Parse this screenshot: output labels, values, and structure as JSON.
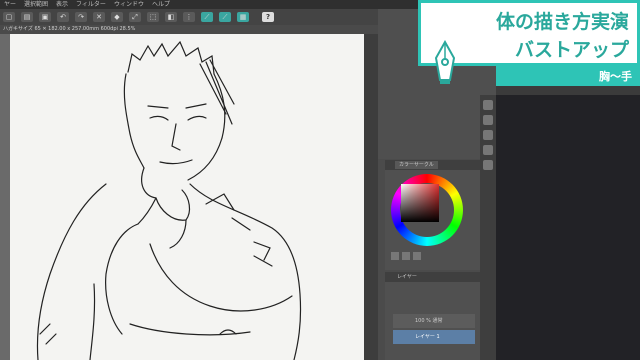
{
  "menu": [
    "ヤー",
    "選択範囲",
    "表示",
    "フィルター",
    "ウィンドウ",
    "ヘルプ"
  ],
  "infobar": "ハガキサイズ 65 ✕ 182.00 x 257.00mm 600dpi 28.5%",
  "toolbar": {
    "help_label": "?"
  },
  "title": {
    "line1": "体の描き方実演",
    "line2": "バストアップ"
  },
  "subtitle": "胸〜手",
  "color_panel": {
    "tab_label": "カラーサークル"
  },
  "layer_panel": {
    "tab_label": "レイヤー",
    "layers": [
      {
        "name": "100 % 通常",
        "selected": false
      },
      {
        "name": "レイヤー 1",
        "selected": true
      }
    ]
  },
  "colors": {
    "accent": "#2ec4b6",
    "title_text": "#2aa89c",
    "layer_selected": "#5c7fa6"
  }
}
